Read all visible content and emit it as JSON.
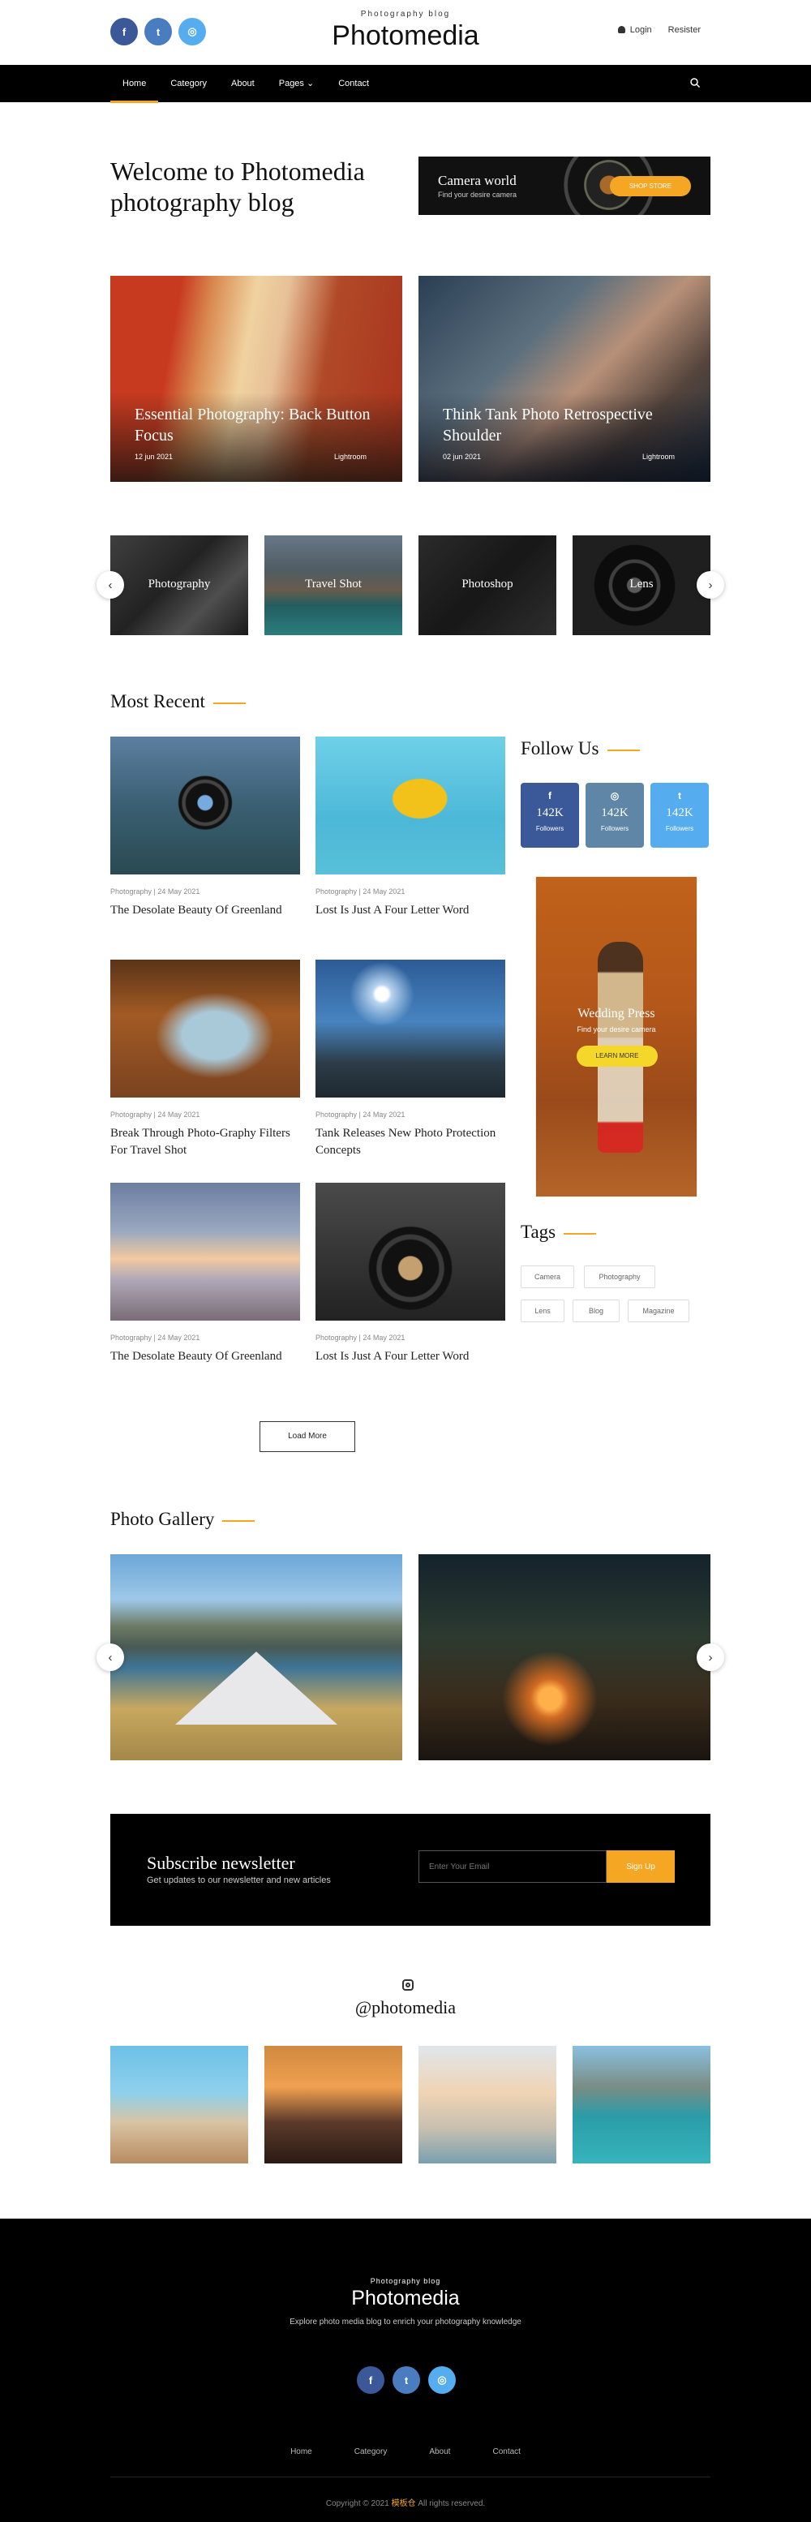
{
  "header": {
    "tagline": "Photography blog",
    "site_name": "Photomedia",
    "login": "Login",
    "register": "Resister"
  },
  "social": [
    {
      "icon": "facebook-icon",
      "glyph": "f"
    },
    {
      "icon": "twitter-icon",
      "glyph": "t"
    },
    {
      "icon": "instagram-icon",
      "glyph": "◎"
    }
  ],
  "nav": {
    "items": [
      "Home",
      "Category",
      "About",
      "Pages ⌄",
      "Contact"
    ],
    "active": "Home"
  },
  "hero": {
    "welcome": "Welcome to Photomedia photography blog",
    "promo": {
      "title": "Camera world",
      "subtitle": "Find your desire camera",
      "button": "SHOP STORE"
    }
  },
  "featured": [
    {
      "title": "Essential Photography: Back Button Focus",
      "date": "12 jun 2021",
      "category": "Lightroom"
    },
    {
      "title": "Think Tank Photo Retrospective Shoulder",
      "date": "02 jun 2021",
      "category": "Lightroom"
    }
  ],
  "categories": [
    "Photography",
    "Travel Shot",
    "Photoshop",
    "Lens"
  ],
  "arrows": {
    "prev": "‹",
    "next": "›"
  },
  "most_recent": {
    "title": "Most Recent",
    "posts": [
      {
        "meta": "Photography | 24 May 2021",
        "title": "The Desolate Beauty Of Greenland"
      },
      {
        "meta": "Photography | 24 May 2021",
        "title": "Lost Is Just A Four Letter Word"
      },
      {
        "meta": "Photography | 24 May 2021",
        "title": "Break Through Photo-Graphy Filters For Travel Shot"
      },
      {
        "meta": "Photography | 24 May 2021",
        "title": "Tank Releases New Photo Protection Concepts"
      },
      {
        "meta": "Photography | 24 May 2021",
        "title": "The Desolate Beauty Of Greenland"
      },
      {
        "meta": "Photography | 24 May 2021",
        "title": "Lost Is Just A Four Letter Word"
      }
    ],
    "load_more": "Load More"
  },
  "sidebar": {
    "follow_title": "Follow Us",
    "follow": [
      {
        "glyph": "f",
        "count": "142K",
        "label": "Followers",
        "color": "#3b5998"
      },
      {
        "glyph": "◎",
        "count": "142K",
        "label": "Followers",
        "color": "#5f86a6"
      },
      {
        "glyph": "t",
        "count": "142K",
        "label": "Followers",
        "color": "#55acee"
      }
    ],
    "banner": {
      "title": "Wedding Press",
      "subtitle": "Find your desire camera",
      "button": "LEARN MORE"
    },
    "tags_title": "Tags",
    "tags": [
      "Camera",
      "Photography",
      "Lens",
      "Blog",
      "Magazine"
    ]
  },
  "gallery": {
    "title": "Photo Gallery"
  },
  "newsletter": {
    "title": "Subscribe newsletter",
    "subtitle": "Get updates to our newsletter and new articles",
    "placeholder": "Enter Your Email",
    "button": "Sign Up"
  },
  "instagram": {
    "handle": "@photomedia"
  },
  "footer": {
    "tagline": "Photography blog",
    "site_name": "Photomedia",
    "description": "Explore photo media blog to enrich your photography knowledge",
    "nav": [
      "Home",
      "Category",
      "About",
      "Contact"
    ],
    "copyright_pre": "Copyright © 2021",
    "copyright_brand": "模板仓",
    "copyright_post": "All rights reserved."
  },
  "colors": {
    "accent": "#f5a623",
    "nav_bg": "#000000",
    "footer_bg": "#000000"
  }
}
